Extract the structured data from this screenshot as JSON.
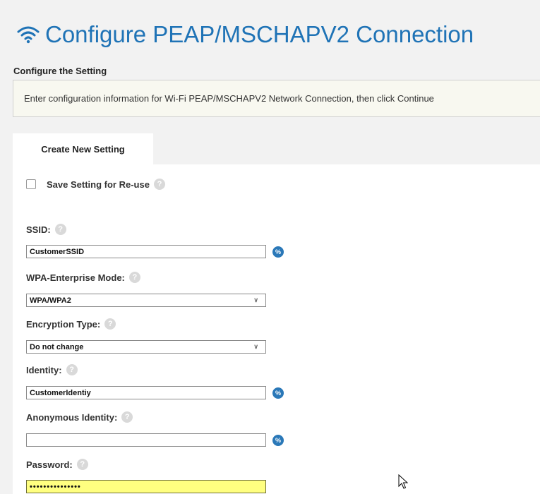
{
  "header": {
    "title": "Configure PEAP/MSCHAPV2 Connection",
    "section_label": "Configure the Setting",
    "info_text": "Enter configuration information for Wi-Fi PEAP/MSCHAPV2 Network Connection, then click Continue"
  },
  "tab": {
    "label": "Create New Setting"
  },
  "form": {
    "save_label": "Save Setting for Re-use",
    "save_checked": false,
    "help_glyph": "?",
    "var_glyph": "%",
    "ssid_label": "SSID:",
    "ssid_value": "CustomerSSID",
    "mode_label": "WPA-Enterprise Mode:",
    "mode_value": "WPA/WPA2",
    "encryption_label": "Encryption Type:",
    "encryption_value": "Do not change",
    "identity_label": "Identity:",
    "identity_value": "CustomerIdentiy",
    "anon_label": "Anonymous Identity:",
    "anon_value": "",
    "password_label": "Password:",
    "password_masked": "•••••••••••••••"
  },
  "colors": {
    "title_blue": "#1f73b6",
    "variable_button": "#2a78b8",
    "active_field": "#ffff80"
  },
  "icons": {
    "title": "wifi-icon",
    "help": "help-icon",
    "variable": "variable-icon",
    "dropdown": "chevron-down-icon",
    "pointer": "mouse-pointer-icon"
  }
}
